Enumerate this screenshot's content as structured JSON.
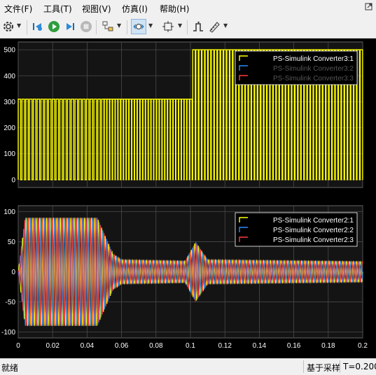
{
  "menubar": {
    "items": [
      "文件(F)",
      "工具(T)",
      "视图(V)",
      "仿真(I)",
      "帮助(H)"
    ]
  },
  "toolbar": {
    "buttons": [
      {
        "icon": "gear-icon",
        "dropdown": true
      },
      {
        "icon": "step-back-icon"
      },
      {
        "icon": "run-icon"
      },
      {
        "icon": "step-forward-icon"
      },
      {
        "icon": "stop-icon"
      },
      {
        "icon": "highlight-model-icon",
        "dropdown": true
      },
      {
        "icon": "zoom-x-icon",
        "dropdown": true,
        "active": true
      },
      {
        "icon": "fit-to-view-icon",
        "dropdown": true
      },
      {
        "icon": "triggers-icon"
      },
      {
        "icon": "cursor-measurements-icon",
        "dropdown": true
      }
    ]
  },
  "colors": {
    "plot_bg": "#000000",
    "axes_bg": "#141414",
    "grid": "#4a4a4a",
    "tick_text": "#ffffff",
    "series1": "#ffff00",
    "series2": "#2b8cff",
    "series3": "#ff3b3b",
    "legend_bg": "#000000",
    "legend_border": "#ffffff"
  },
  "chart_data": [
    {
      "type": "line",
      "xlim": [
        0,
        0.2
      ],
      "ylim": [
        -30,
        530
      ],
      "yticks": [
        "500",
        "400",
        "300",
        "200",
        "100",
        "0"
      ],
      "grid": true,
      "legend_position": "top-right",
      "series": [
        {
          "name": "PS-Simulink Converter3:1",
          "color": "#ffff00",
          "description_points": [
            {
              "x": 0,
              "y": 0
            },
            {
              "x": 0.1,
              "y": 310
            },
            {
              "x": 0.2,
              "y": 500
            }
          ],
          "levels": {
            "phase1_high": 310,
            "phase2_high": 500,
            "low": 0
          },
          "switch_time": 0.1
        },
        {
          "name": "PS-Simulink Converter3:2",
          "color": "#2b8cff"
        },
        {
          "name": "PS-Simulink Converter3:3",
          "color": "#ff3b3b"
        }
      ]
    },
    {
      "type": "line",
      "xlim": [
        0,
        0.2
      ],
      "ylim": [
        -110,
        110
      ],
      "yticks": [
        "100",
        "50",
        "0",
        "-50",
        "-100"
      ],
      "xticks": [
        "0",
        "0.02",
        "0.04",
        "0.06",
        "0.08",
        "0.1",
        "0.12",
        "0.14",
        "0.16",
        "0.18",
        "0.2"
      ],
      "grid": true,
      "legend_position": "top-right",
      "series": [
        {
          "name": "PS-Simulink Converter2:1",
          "color": "#ffff00"
        },
        {
          "name": "PS-Simulink Converter2:2",
          "color": "#2b8cff"
        },
        {
          "name": "PS-Simulink Converter2:3",
          "color": "#ff3b3b"
        }
      ],
      "envelope": [
        {
          "t": 0.0,
          "amp": 0
        },
        {
          "t": 0.004,
          "amp": 90
        },
        {
          "t": 0.046,
          "amp": 90
        },
        {
          "t": 0.055,
          "amp": 30
        },
        {
          "t": 0.06,
          "amp": 20
        },
        {
          "t": 0.097,
          "amp": 18
        },
        {
          "t": 0.103,
          "amp": 50
        },
        {
          "t": 0.11,
          "amp": 20
        },
        {
          "t": 0.2,
          "amp": 17
        }
      ]
    }
  ],
  "status": {
    "left": "就绪",
    "mode": "基于采样",
    "time": "T=0.200"
  }
}
